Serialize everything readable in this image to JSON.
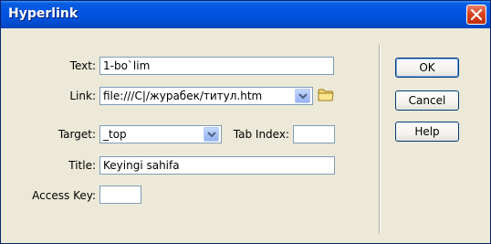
{
  "dialog": {
    "title": "Hyperlink"
  },
  "form": {
    "text_label": "Text:",
    "text_value": "1-bo`lim",
    "link_label": "Link:",
    "link_value": "file:///C|/журабек/титул.htm",
    "target_label": "Target:",
    "target_value": "_top",
    "tab_index_label": "Tab Index:",
    "tab_index_value": "",
    "title_label": "Title:",
    "title_value": "Keyingi sahifa",
    "access_key_label": "Access Key:",
    "access_key_value": ""
  },
  "buttons": {
    "ok": "OK",
    "cancel": "Cancel",
    "help": "Help"
  },
  "icons": {
    "close": "close-icon",
    "browse": "folder-icon",
    "dropdown": "chevron-down-icon"
  },
  "colors": {
    "titlebar": "#0054e3",
    "close_button": "#d8431f",
    "dialog_bg": "#ece9d8",
    "field_border": "#7f9db9"
  }
}
